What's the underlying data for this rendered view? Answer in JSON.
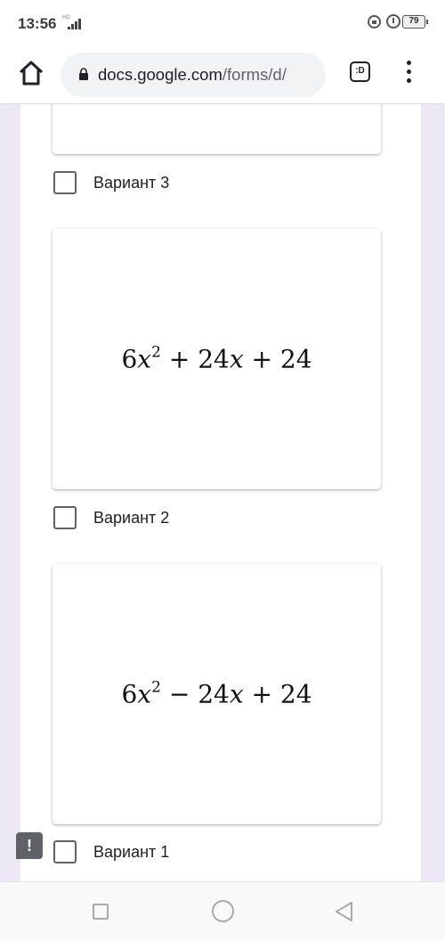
{
  "status_bar": {
    "time": "13:56",
    "network_label": "HD",
    "battery": "79",
    "icons": [
      "signal-icon",
      "lock-rotation-icon",
      "alarm-icon",
      "battery-icon"
    ]
  },
  "browser": {
    "url_host": "docs.google.com",
    "url_path": "/forms/d/",
    "tabs_label": ":D",
    "icons": [
      "home-icon",
      "lock-icon",
      "tabs-icon",
      "overflow-menu-icon"
    ]
  },
  "form": {
    "options": [
      {
        "label": "Вариант 3"
      },
      {
        "label": "Вариант 2",
        "formula": {
          "coef": "6",
          "var": "x",
          "exp": "2",
          "op1": "+",
          "mid": "24",
          "op2": "+",
          "const": "24"
        }
      },
      {
        "label": "Вариант 1",
        "formula": {
          "coef": "6",
          "var": "x",
          "exp": "2",
          "op1": "−",
          "mid": "24",
          "op2": "+",
          "const": "24"
        }
      }
    ]
  },
  "feedback": {
    "symbol": "!"
  },
  "nav": {
    "icons": [
      "recents-icon",
      "home-circle-icon",
      "back-icon"
    ]
  },
  "colors": {
    "page_bg": "#ebe7f4",
    "card_bg": "#ffffff",
    "checkbox": "#5f6368"
  }
}
